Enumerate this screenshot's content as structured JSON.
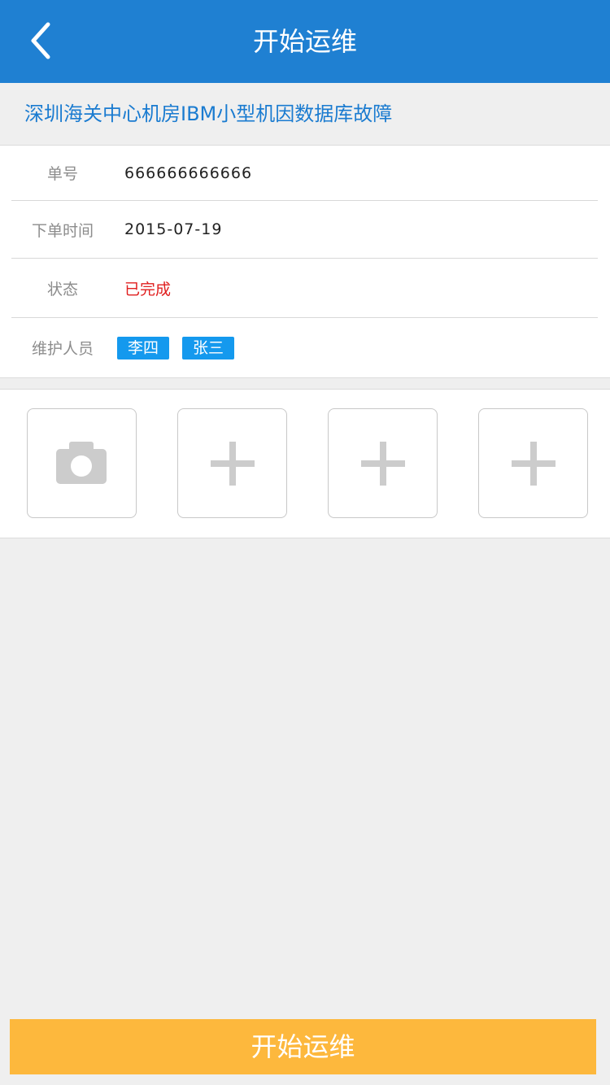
{
  "header": {
    "title": "开始运维",
    "back_icon": "chevron-left-icon"
  },
  "task": {
    "title": "深圳海关中心机房IBM小型机因数据库故障"
  },
  "info": {
    "order_no_label": "单号",
    "order_no_value": "666666666666",
    "order_time_label": "下单时间",
    "order_time_value": "2015-07-19",
    "status_label": "状态",
    "status_value": "已完成",
    "status_color": "#e01e1e",
    "staff_label": "维护人员",
    "staff": [
      "李四",
      "张三"
    ],
    "tag_color": "#1499ee"
  },
  "photos": {
    "items": [
      {
        "icon": "camera-icon"
      },
      {
        "icon": "plus-icon"
      },
      {
        "icon": "plus-icon"
      },
      {
        "icon": "plus-icon"
      }
    ]
  },
  "footer": {
    "start_button_label": "开始运维",
    "button_color": "#fdb83d"
  },
  "theme": {
    "primary": "#1f80d2",
    "background": "#efefef"
  }
}
